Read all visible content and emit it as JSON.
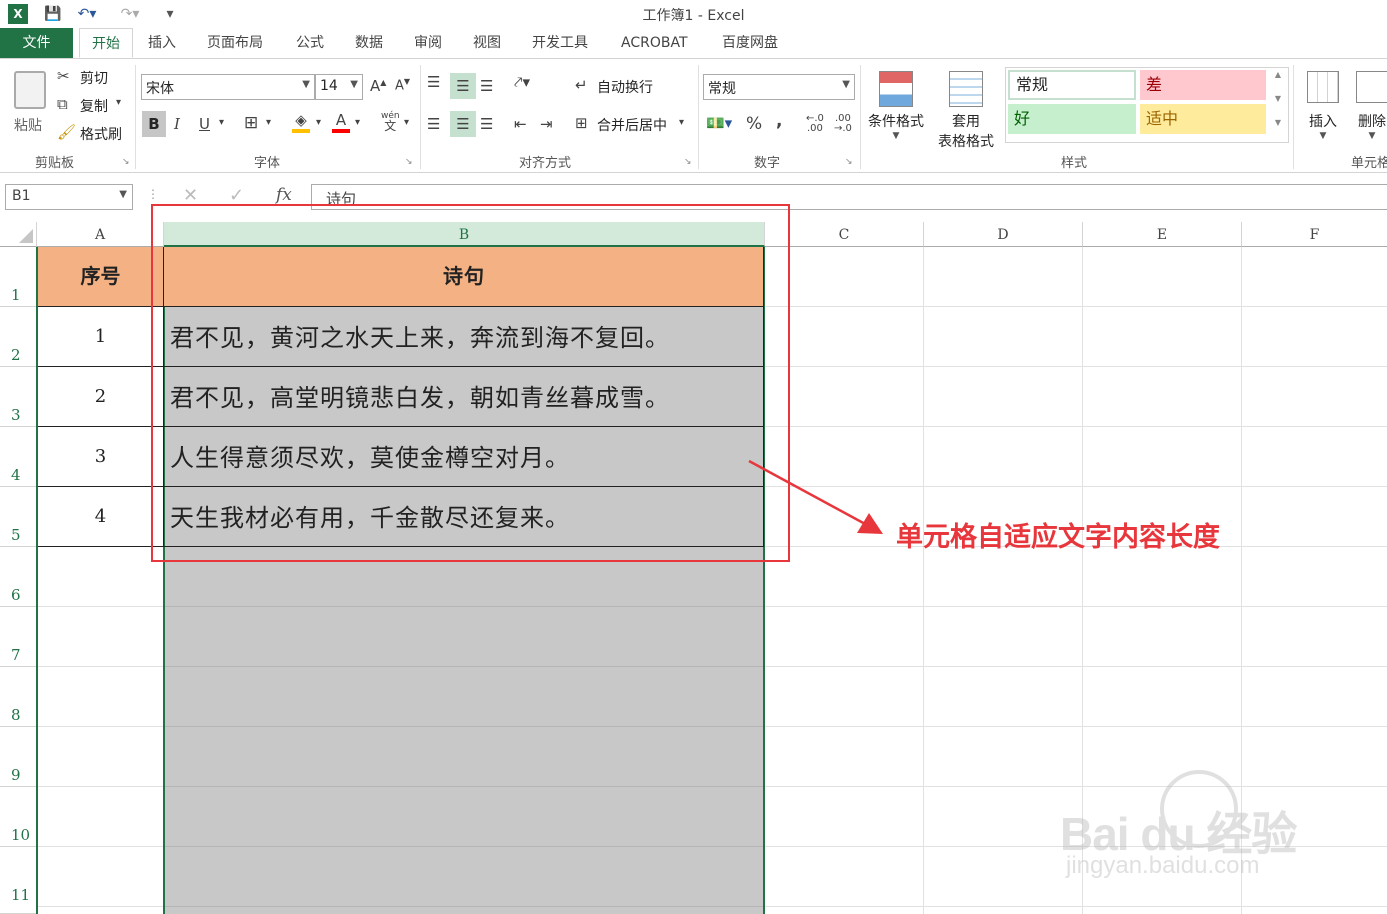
{
  "window": {
    "title": "工作簿1 - Excel"
  },
  "tabs": [
    "文件",
    "开始",
    "插入",
    "页面布局",
    "公式",
    "数据",
    "审阅",
    "视图",
    "开发工具",
    "ACROBAT",
    "百度网盘"
  ],
  "clipboard": {
    "paste": "粘贴",
    "cut": "剪切",
    "copy": "复制",
    "format_painter": "格式刷",
    "label": "剪贴板"
  },
  "font": {
    "name": "宋体",
    "size": "14",
    "label": "字体",
    "bold": "B",
    "italic": "I",
    "underline": "U",
    "wen": "wén"
  },
  "alignment": {
    "wrap": "自动换行",
    "merge": "合并后居中",
    "label": "对齐方式"
  },
  "number": {
    "format": "常规",
    "percent": "%",
    "comma": ",",
    "label": "数字"
  },
  "styles": {
    "cond_format": "条件格式",
    "table_format_1": "套用",
    "table_format_2": "表格格式",
    "normal": "常规",
    "bad": "差",
    "good": "好",
    "neutral": "适中",
    "label": "样式"
  },
  "cells_group": {
    "insert": "插入",
    "delete": "删除",
    "label": "单元格"
  },
  "formula_bar": {
    "name_box": "B1",
    "content": "诗句",
    "fx": "fx"
  },
  "columns": [
    "A",
    "B",
    "C",
    "D",
    "E",
    "F"
  ],
  "rows": [
    "1",
    "2",
    "3",
    "4",
    "5",
    "6",
    "7",
    "8",
    "9",
    "10",
    "11"
  ],
  "table": {
    "header_a": "序号",
    "header_b": "诗句",
    "data": [
      {
        "no": "1",
        "poem": "君不见，黄河之水天上来，奔流到海不复回。"
      },
      {
        "no": "2",
        "poem": "君不见，高堂明镜悲白发，朝如青丝暮成雪。"
      },
      {
        "no": "3",
        "poem": "人生得意须尽欢，莫使金樽空对月。"
      },
      {
        "no": "4",
        "poem": "天生我材必有用，千金散尽还复来。"
      }
    ]
  },
  "annotation": "单元格自适应文字内容长度",
  "watermark": {
    "brand": "Bai du 经验",
    "url": "jingyan.baidu.com"
  },
  "colors": {
    "excel_green": "#217346",
    "header_fill": "#f4b183",
    "selection_gray": "#c8c8c8",
    "annotation_red": "#e8373c"
  }
}
